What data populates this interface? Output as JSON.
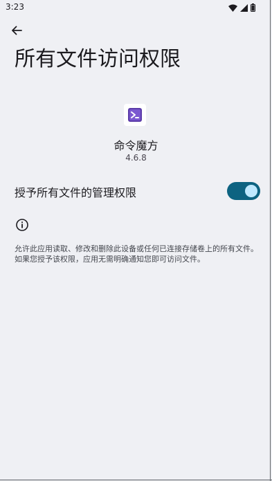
{
  "status_bar": {
    "time": "3:23",
    "icons": [
      "wifi-icon",
      "signal-icon",
      "battery-icon"
    ]
  },
  "header": {
    "title": "所有文件访问权限"
  },
  "app": {
    "name": "命令魔方",
    "version": "4.6.8"
  },
  "permission": {
    "label": "授予所有文件的管理权限",
    "enabled": true
  },
  "info": {
    "icon": "info-icon",
    "description": "允许此应用读取、修改和删除此设备或任何已连接存储卷上的所有文件。如果您授予该权限，应用无需明确通知您即可访问文件。"
  },
  "colors": {
    "background": "#eff0f4",
    "toggle_track": "#0d6381",
    "toggle_thumb": "#bfe9ff"
  }
}
